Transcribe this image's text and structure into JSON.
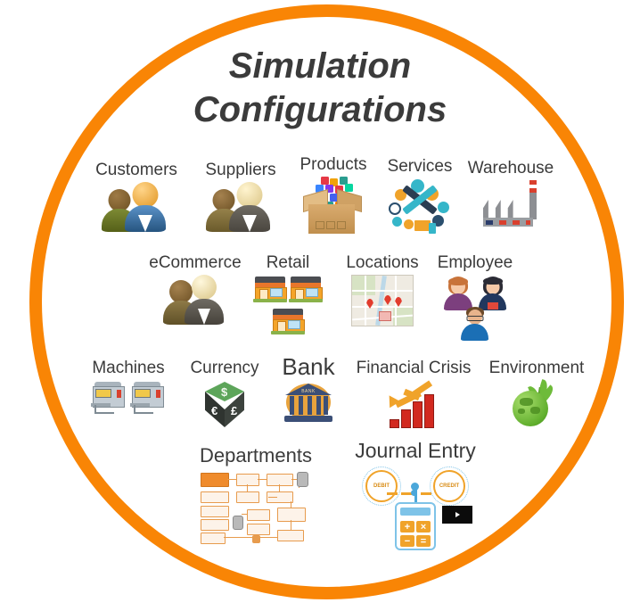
{
  "theme": {
    "ring_color": "#F98505",
    "background": "#FFFFFF",
    "text_color": "#3B3B3B"
  },
  "title": {
    "line1": "Simulation",
    "line2": "Configurations"
  },
  "items": [
    {
      "id": "customers",
      "label": "Customers",
      "icon": "two-people-icon"
    },
    {
      "id": "suppliers",
      "label": "Suppliers",
      "icon": "two-people-icon"
    },
    {
      "id": "products",
      "label": "Products",
      "icon": "box-of-products-icon"
    },
    {
      "id": "services",
      "label": "Services",
      "icon": "tools-services-icon"
    },
    {
      "id": "warehouse",
      "label": "Warehouse",
      "icon": "factory-icon"
    },
    {
      "id": "ecommerce",
      "label": "eCommerce",
      "icon": "two-people-icon"
    },
    {
      "id": "retail",
      "label": "Retail",
      "icon": "storefronts-icon"
    },
    {
      "id": "locations",
      "label": "Locations",
      "icon": "map-pins-icon"
    },
    {
      "id": "employee",
      "label": "Employee",
      "icon": "employee-avatars-icon"
    },
    {
      "id": "machines",
      "label": "Machines",
      "icon": "machines-icon"
    },
    {
      "id": "currency",
      "label": "Currency",
      "icon": "currency-cube-icon"
    },
    {
      "id": "bank",
      "label": "Bank",
      "icon": "bank-building-icon"
    },
    {
      "id": "financial-crisis",
      "label": "Financial Crisis",
      "icon": "declining-chart-icon"
    },
    {
      "id": "environment",
      "label": "Environment",
      "icon": "green-globe-plant-icon"
    },
    {
      "id": "departments",
      "label": "Departments",
      "icon": "flowchart-icon"
    },
    {
      "id": "journal-entry",
      "label": "Journal Entry",
      "icon": "calculator-debit-credit-icon"
    }
  ],
  "currency_cube": {
    "top_symbol": "$",
    "left_symbol": "€",
    "right_symbol": "£"
  },
  "bank_icon": {
    "sign_text": "BANK"
  },
  "journal_entry_icon": {
    "debit_label": "DEBIT",
    "credit_label": "CREDIT",
    "keys": [
      "+",
      "×",
      "−",
      "="
    ]
  }
}
